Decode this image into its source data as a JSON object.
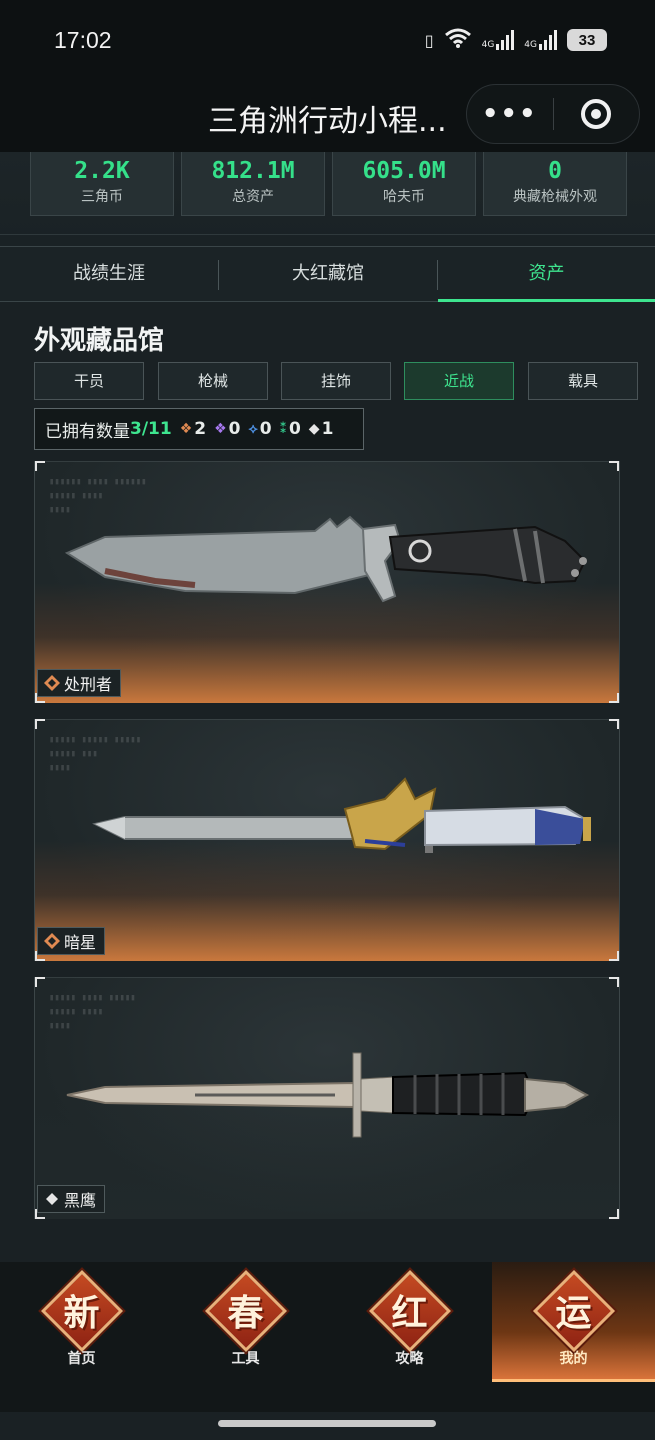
{
  "status_bar": {
    "time": "17:02",
    "battery": "33",
    "network_1": "4G",
    "network_2": "4G"
  },
  "header": {
    "title": "三角洲行动小程..."
  },
  "stats": [
    {
      "value": "2.2K",
      "label": "三角币"
    },
    {
      "value": "812.1M",
      "label": "总资产"
    },
    {
      "value": "605.0M",
      "label": "哈夫币"
    },
    {
      "value": "0",
      "label": "典藏枪械外观"
    }
  ],
  "tabs": [
    "战绩生涯",
    "大红藏馆",
    "资产"
  ],
  "active_tab": "资产",
  "section": {
    "title": "外观藏品馆"
  },
  "categories": [
    "干员",
    "枪械",
    "挂饰",
    "近战",
    "载具"
  ],
  "active_category": "近战",
  "owned": {
    "label": "已拥有数量",
    "count": "3/11",
    "tiers": [
      {
        "value": "2",
        "color": "#e08a52"
      },
      {
        "value": "0",
        "color": "#a779f0"
      },
      {
        "value": "0",
        "color": "#4d8fe0"
      },
      {
        "value": "0",
        "color": "#33c58a"
      },
      {
        "value": "1",
        "color": "#e6e6e6"
      }
    ]
  },
  "items": [
    {
      "name": "处刑者",
      "rarity_color": "#e08a52"
    },
    {
      "name": "暗星",
      "rarity_color": "#e08a52"
    },
    {
      "name": "黑鹰",
      "rarity_color": "#e6e6e6"
    }
  ],
  "bottom_nav": [
    {
      "char": "新",
      "label": "首页"
    },
    {
      "char": "春",
      "label": "工具"
    },
    {
      "char": "红",
      "label": "攻略"
    },
    {
      "char": "运",
      "label": "我的"
    }
  ],
  "active_nav": "我的"
}
